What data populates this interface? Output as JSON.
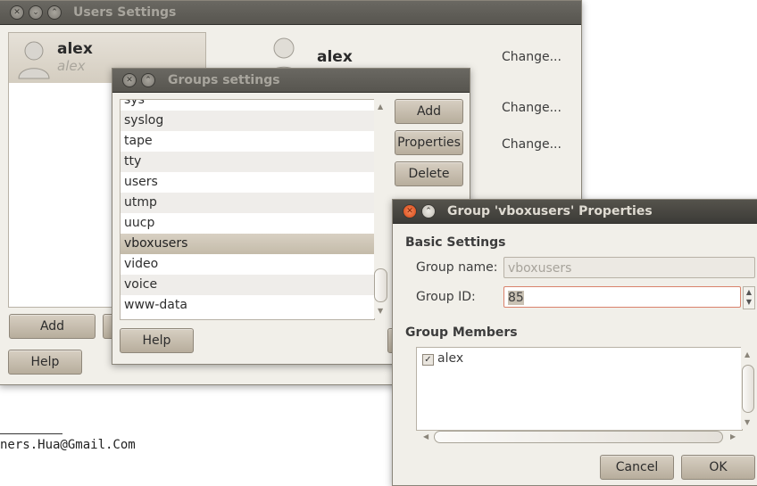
{
  "users_window": {
    "title": "Users Settings",
    "sidebar_user": {
      "name": "alex",
      "login": "alex"
    },
    "detail_user": {
      "name": "alex"
    },
    "change_labels": [
      "Change...",
      "Change...",
      "Change..."
    ],
    "add_label": "Add",
    "help_label": "Help"
  },
  "groups_window": {
    "title": "Groups settings",
    "groups": [
      "sys",
      "syslog",
      "tape",
      "tty",
      "users",
      "utmp",
      "uucp",
      "vboxusers",
      "video",
      "voice",
      "www-data"
    ],
    "selected_group": "vboxusers",
    "add_label": "Add",
    "properties_label": "Properties",
    "delete_label": "Delete",
    "help_label": "Help"
  },
  "properties_window": {
    "title": "Group 'vboxusers' Properties",
    "basic_heading": "Basic Settings",
    "group_name_label": "Group name:",
    "group_name_value": "vboxusers",
    "group_id_label": "Group ID:",
    "group_id_value": "85",
    "members_heading": "Group Members",
    "members": [
      {
        "name": "alex",
        "checked": true
      }
    ],
    "cancel_label": "Cancel",
    "ok_label": "OK"
  },
  "watermark": "ners.Hua@Gmail.Com",
  "colors": {
    "titlebar": "#3c3b37",
    "window_bg": "#f1efe9",
    "button": "#c8bfb0",
    "close_button": "#e0531c",
    "selection": "#cfc6b6"
  }
}
